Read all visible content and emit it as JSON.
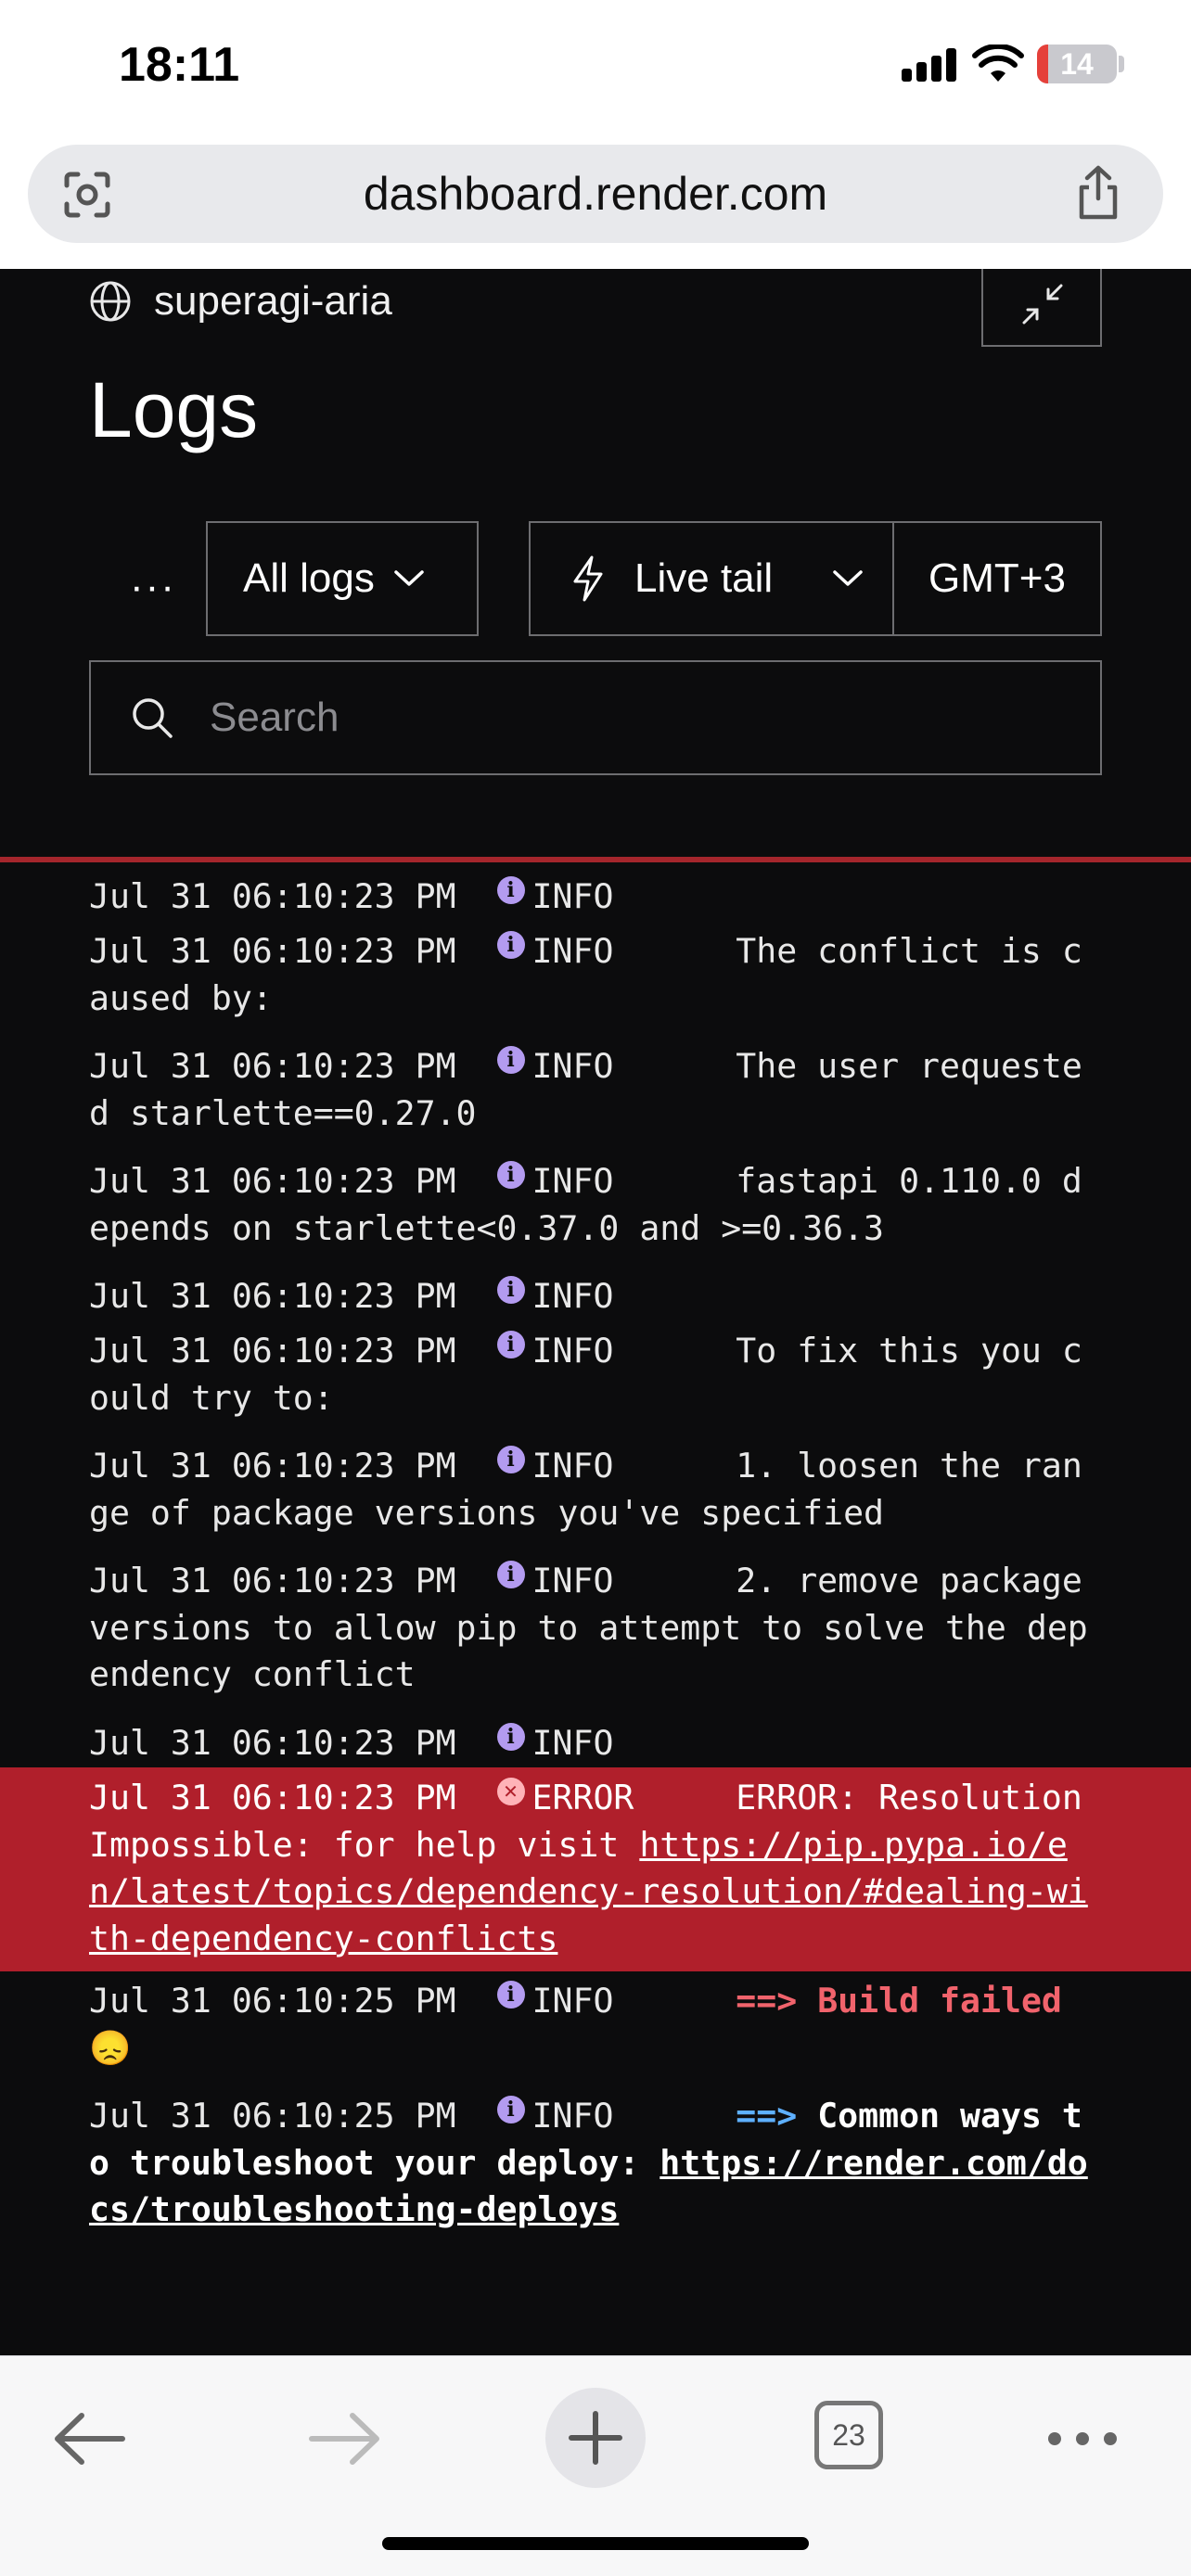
{
  "status_bar": {
    "time": "18:11",
    "battery": "14",
    "battery_level": 0.14
  },
  "browser": {
    "url": "dashboard.render.com",
    "tab_count": "23"
  },
  "service": {
    "name": "superagi-aria"
  },
  "page": {
    "title": "Logs"
  },
  "controls": {
    "more_label": "···",
    "log_filter": "All logs",
    "live_tail": "Live tail",
    "timezone": "GMT+3",
    "search_placeholder": "Search"
  },
  "logs": [
    {
      "time": "Jul 31 06:10:23 PM",
      "level": "INFO",
      "message": ""
    },
    {
      "time": "Jul 31 06:10:23 PM",
      "level": "INFO",
      "message": "The conflict is caused by:"
    },
    {
      "time": "Jul 31 06:10:23 PM",
      "level": "INFO",
      "message": "The user requested starlette==0.27.0"
    },
    {
      "time": "Jul 31 06:10:23 PM",
      "level": "INFO",
      "message": "fastapi 0.110.0 depends on starlette<0.37.0 and >=0.36.3"
    },
    {
      "time": "Jul 31 06:10:23 PM",
      "level": "INFO",
      "message": ""
    },
    {
      "time": "Jul 31 06:10:23 PM",
      "level": "INFO",
      "message": "To fix this you could try to:"
    },
    {
      "time": "Jul 31 06:10:23 PM",
      "level": "INFO",
      "message": "1. loosen the range of package versions you've specified"
    },
    {
      "time": "Jul 31 06:10:23 PM",
      "level": "INFO",
      "message": "2. remove package versions to allow pip to attempt to solve the dependency conflict"
    },
    {
      "time": "Jul 31 06:10:23 PM",
      "level": "INFO",
      "message": ""
    },
    {
      "time": "Jul 31 06:10:23 PM",
      "level": "ERROR",
      "message": "ERROR: ResolutionImpossible: for help visit ",
      "link": "https://pip.pypa.io/en/latest/topics/dependency-resolution/#dealing-with-dependency-conflicts"
    },
    {
      "time": "Jul 31 06:10:25 PM",
      "level": "INFO",
      "arrow": "==>",
      "message": "Build failed",
      "emoji": "😞"
    },
    {
      "time": "Jul 31 06:10:25 PM",
      "level": "INFO",
      "arrow": "==>",
      "message": "Common ways to troubleshoot your deploy: ",
      "link": "https://render.com/docs/troubleshooting-deploys"
    }
  ]
}
